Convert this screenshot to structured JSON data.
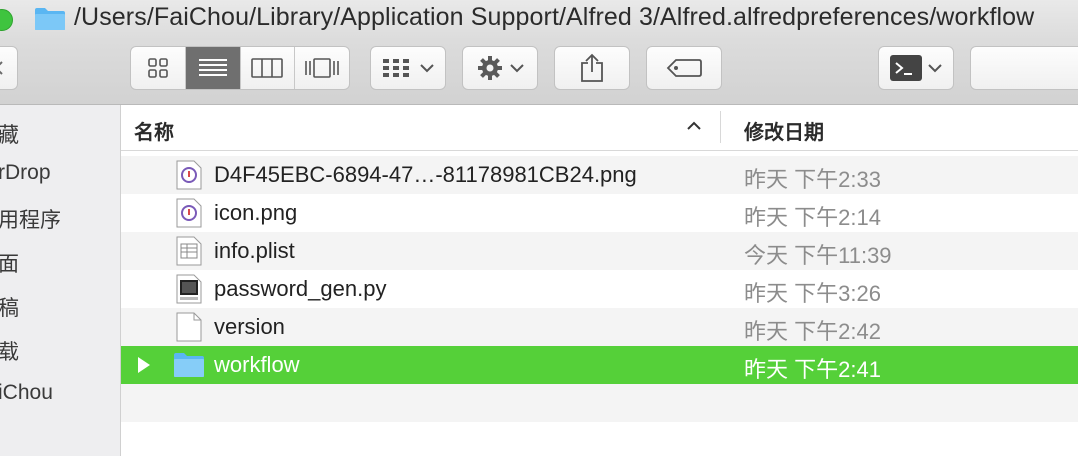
{
  "window": {
    "title_path": "/Users/FaiChou/Library/Application Support/Alfred 3/Alfred.alfredpreferences/workflow"
  },
  "toolbar": {
    "view_modes": [
      "icon-view",
      "list-view",
      "column-view",
      "cover-flow-view"
    ],
    "active_view": "list-view",
    "buttons": [
      "arrange-menu",
      "action-menu",
      "share",
      "tags",
      "terminal-menu"
    ]
  },
  "sidebar": {
    "items": [
      {
        "label": "藏"
      },
      {
        "label": "rDrop"
      },
      {
        "label": "用程序"
      },
      {
        "label": "面"
      },
      {
        "label": "稿"
      },
      {
        "label": "载"
      },
      {
        "label": "iChou"
      }
    ]
  },
  "list": {
    "columns": {
      "name": "名称",
      "date": "修改日期"
    },
    "rows": [
      {
        "name": "D4F45EBC-6894-47…-81178981CB24.png",
        "date": "昨天 下午2:33",
        "icon": "png-file-icon"
      },
      {
        "name": "icon.png",
        "date": "昨天 下午2:14",
        "icon": "png-file-icon"
      },
      {
        "name": "info.plist",
        "date": "今天 下午11:39",
        "icon": "plist-file-icon"
      },
      {
        "name": "password_gen.py",
        "date": "昨天 下午3:26",
        "icon": "python-file-icon"
      },
      {
        "name": "version",
        "date": "昨天 下午2:42",
        "icon": "blank-file-icon"
      },
      {
        "name": "workflow",
        "date": "昨天 下午2:41",
        "icon": "folder-icon",
        "selected": true
      }
    ]
  },
  "colors": {
    "selection": "#55d039",
    "folder": "#5ab6f2"
  }
}
